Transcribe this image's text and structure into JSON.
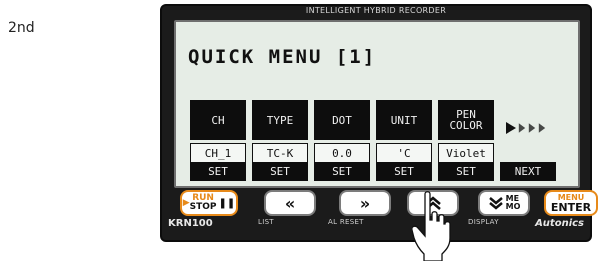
{
  "step_label": "2nd",
  "device": {
    "title": "INTELLIGENT HYBRID RECORDER",
    "model": "KRN100",
    "brand": "Autonics"
  },
  "screen": {
    "title": "QUICK MENU [1]",
    "columns": [
      {
        "header": "CH",
        "value": "CH_1"
      },
      {
        "header": "TYPE",
        "value": "TC-K"
      },
      {
        "header": "DOT",
        "value": "0.0"
      },
      {
        "header": "UNIT",
        "value": "'C"
      },
      {
        "header": "PEN\nCOLOR",
        "value": "Violet"
      }
    ],
    "softkeys": [
      "SET",
      "SET",
      "SET",
      "SET",
      "SET",
      "NEXT"
    ]
  },
  "buttons": {
    "run_top": "RUN",
    "run_bottom": "STOP",
    "display_small": "ME\nMO",
    "enter_top": "MENU",
    "enter_bottom": "ENTER"
  },
  "captions": {
    "list": "LIST",
    "alreset": "AL RESET",
    "display": "DISPLAY"
  }
}
